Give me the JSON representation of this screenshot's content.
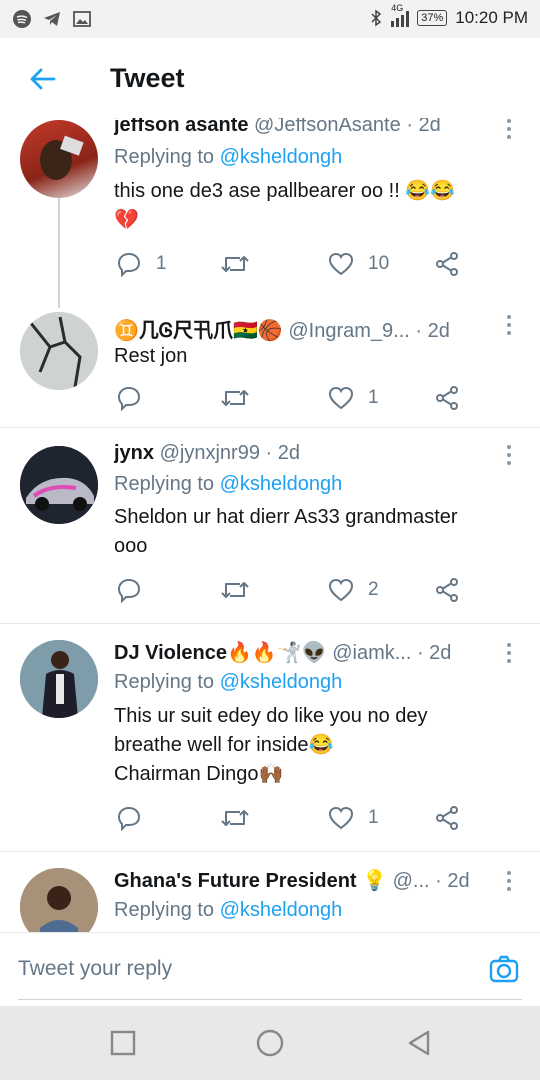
{
  "status_bar": {
    "network": "4G",
    "battery": "37%",
    "time": "10:20 PM"
  },
  "header": {
    "title": "Tweet"
  },
  "tweets": [
    {
      "name": "jeffson asante",
      "handle": "@JeffsonAsante",
      "time": "· 2d",
      "replying_label": "Replying to",
      "replying_to": "@ksheldongh",
      "text_line1": "this one de3 ase  pallbearer oo !! 😂😂",
      "text_line2": "💔",
      "replies": "1",
      "likes": "10"
    },
    {
      "name": "♊几Ꮆ尺卂爪🇬🇭🏀",
      "handle": "@Ingram_9...",
      "time": "· 2d",
      "text_line1": "Rest jon",
      "replies": "",
      "likes": "1"
    },
    {
      "name": "jynx",
      "handle": "@jynxjnr99",
      "time": "· 2d",
      "replying_label": "Replying to",
      "replying_to": "@ksheldongh",
      "text_line1": "Sheldon ur hat dierr As33 grandmaster",
      "text_line2": "ooo",
      "replies": "",
      "likes": "2"
    },
    {
      "name": "DJ Violence🔥🔥🤺👽",
      "handle": "@iamk...",
      "time": "· 2d",
      "replying_label": "Replying to",
      "replying_to": "@ksheldongh",
      "text_line1": "This ur suit edey do like you no dey",
      "text_line2": "breathe well for inside😂",
      "text_line3": "Chairman Dingo🙌🏾",
      "replies": "",
      "likes": "1"
    },
    {
      "name": "Ghana's Future President 💡",
      "handle": "@...",
      "time": "· 2d",
      "replying_label": "Replying to",
      "replying_to": "@ksheldongh"
    }
  ],
  "composer": {
    "placeholder": "Tweet your reply"
  },
  "colors": {
    "accent": "#1da1f2",
    "secondary_text": "#657786",
    "divider": "#e1e8ed"
  }
}
